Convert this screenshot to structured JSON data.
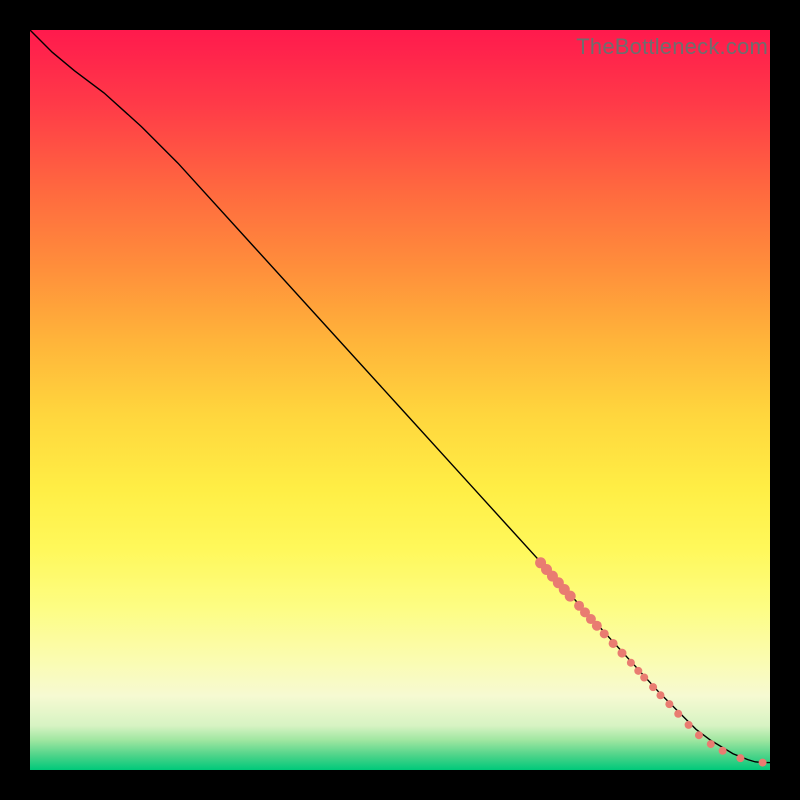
{
  "watermark": "TheBottleneck.com",
  "colors": {
    "marker": "#e97c71",
    "line": "#000000"
  },
  "chart_data": {
    "type": "line",
    "title": "",
    "xlabel": "",
    "ylabel": "",
    "xlim": [
      0,
      100
    ],
    "ylim": [
      0,
      100
    ],
    "grid": false,
    "legend": false,
    "series": [
      {
        "name": "curve",
        "x": [
          0,
          3,
          6,
          10,
          15,
          20,
          30,
          40,
          50,
          60,
          70,
          75,
          80,
          85,
          88,
          90,
          92,
          94,
          95,
          96,
          97,
          98,
          99,
          100
        ],
        "y": [
          100,
          97,
          94.5,
          91.5,
          87,
          82,
          71,
          60,
          49,
          38,
          27,
          21.5,
          16,
          10.5,
          7.5,
          5.5,
          4,
          2.8,
          2.2,
          1.8,
          1.4,
          1.1,
          1.0,
          1.0
        ]
      }
    ],
    "markers": [
      {
        "x": 69.0,
        "y": 28.0,
        "r": 5.5
      },
      {
        "x": 69.8,
        "y": 27.1,
        "r": 5.5
      },
      {
        "x": 70.6,
        "y": 26.2,
        "r": 5.5
      },
      {
        "x": 71.4,
        "y": 25.3,
        "r": 5.5
      },
      {
        "x": 72.2,
        "y": 24.4,
        "r": 5.5
      },
      {
        "x": 73.0,
        "y": 23.5,
        "r": 5.5
      },
      {
        "x": 74.2,
        "y": 22.2,
        "r": 5.0
      },
      {
        "x": 75.0,
        "y": 21.3,
        "r": 5.0
      },
      {
        "x": 75.8,
        "y": 20.4,
        "r": 5.0
      },
      {
        "x": 76.6,
        "y": 19.5,
        "r": 5.0
      },
      {
        "x": 77.6,
        "y": 18.4,
        "r": 4.5
      },
      {
        "x": 78.8,
        "y": 17.1,
        "r": 4.5
      },
      {
        "x": 80.0,
        "y": 15.8,
        "r": 4.5
      },
      {
        "x": 81.2,
        "y": 14.5,
        "r": 4.0
      },
      {
        "x": 82.2,
        "y": 13.4,
        "r": 4.0
      },
      {
        "x": 83.0,
        "y": 12.5,
        "r": 4.0
      },
      {
        "x": 84.2,
        "y": 11.2,
        "r": 4.0
      },
      {
        "x": 85.2,
        "y": 10.1,
        "r": 4.0
      },
      {
        "x": 86.4,
        "y": 8.9,
        "r": 4.0
      },
      {
        "x": 87.6,
        "y": 7.6,
        "r": 4.0
      },
      {
        "x": 89.0,
        "y": 6.1,
        "r": 4.0
      },
      {
        "x": 90.4,
        "y": 4.7,
        "r": 4.0
      },
      {
        "x": 92.0,
        "y": 3.5,
        "r": 4.0
      },
      {
        "x": 93.6,
        "y": 2.6,
        "r": 4.0
      },
      {
        "x": 96.0,
        "y": 1.6,
        "r": 4.0
      },
      {
        "x": 99.0,
        "y": 1.0,
        "r": 4.0
      }
    ]
  }
}
